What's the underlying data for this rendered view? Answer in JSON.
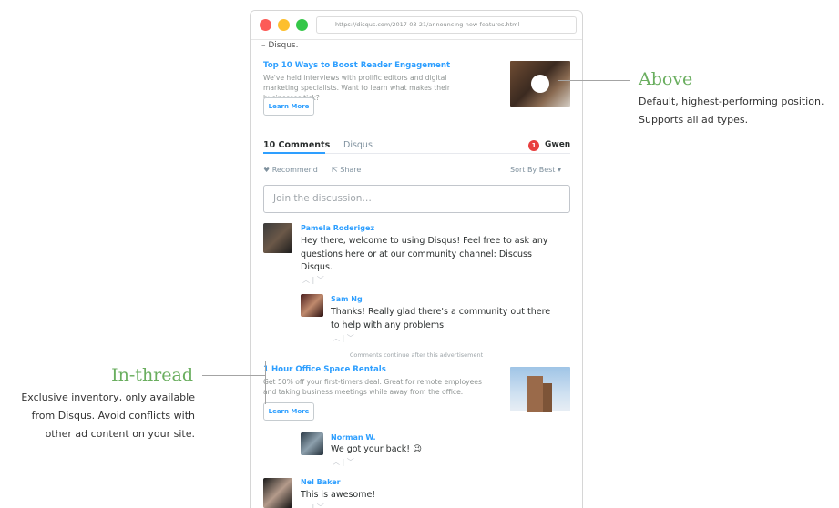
{
  "browser": {
    "url": "https://disqus.com/2017-03-21/announcing-new-features.html"
  },
  "page": {
    "cut_text": "– Disqus."
  },
  "top_ad": {
    "title": "Top 10 Ways to Boost Reader Engagement",
    "body": "We've held interviews with prolific editors and digital marketing specialists. Want to learn what makes their businesses tick?",
    "button": "Learn More"
  },
  "tabs": {
    "comments": "10 Comments",
    "community": "Disqus",
    "notification_count": "1",
    "user": "Gwen"
  },
  "actions": {
    "recommend": "Recommend",
    "share": "Share",
    "sort": "Sort By Best"
  },
  "composer": {
    "placeholder": "Join the discussion…"
  },
  "comments": [
    {
      "author": "Pamela Roderigez",
      "text": "Hey there, welcome to using Disqus! Feel free to ask any questions here or at our community channel: Discuss Disqus."
    },
    {
      "author": "Sam Ng",
      "text": "Thanks! Really glad there's a community out there to help with any problems."
    },
    {
      "author": "Norman W.",
      "text": "We got your back! 😉"
    },
    {
      "author": "Nel Baker",
      "text": "This is awesome!"
    }
  ],
  "inline_ad": {
    "note": "Comments continue after this advertisement",
    "title": "1 Hour Office Space Rentals",
    "body": "Get 50% off your first-timers deal. Great for remote employees and taking business meetings while away from the office.",
    "button": "Learn More"
  },
  "callouts": {
    "above": {
      "title": "Above",
      "desc": "Default, highest-performing position. Supports all ad types."
    },
    "in_thread": {
      "title": "In-thread",
      "desc": "Exclusive inventory, only available from Disqus. Avoid conflicts with other ad content on your site."
    }
  },
  "colors": {
    "accent": "#2e9fff",
    "callout_green": "#6aae5f",
    "notification_red": "#e83f3f"
  }
}
